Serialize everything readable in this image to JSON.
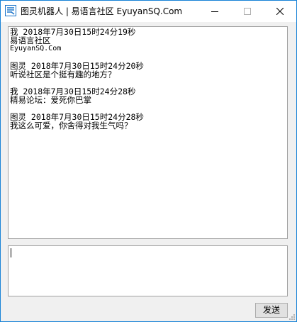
{
  "window": {
    "title": "图灵机器人 | 易语言社区 EyuyanSQ.Com"
  },
  "caption_buttons": {
    "minimize": "minimize-icon",
    "maximize": "maximize-icon",
    "close": "close-icon"
  },
  "chat": {
    "messages": [
      {
        "header": "我 2018年7月30日15时24分19秒",
        "lines": [
          "易语言社区",
          "EyuyanSQ.Com"
        ]
      },
      {
        "header": "图灵 2018年7月30日15时24分20秒",
        "lines": [
          "听说社区是个挺有趣的地方？"
        ]
      },
      {
        "header": "我 2018年7月30日15时24分28秒",
        "lines": [
          "精易论坛：爱死你巴掌"
        ]
      },
      {
        "header": "图灵 2018年7月30日15时24分28秒",
        "lines": [
          "我这么可爱，你舍得对我生气吗？"
        ]
      }
    ]
  },
  "input": {
    "value": ""
  },
  "send_button": {
    "label": "发送"
  },
  "colors": {
    "window_border": "#1883d7",
    "window_bg": "#f0f0f0",
    "icon_accent": "#1a73c9"
  }
}
